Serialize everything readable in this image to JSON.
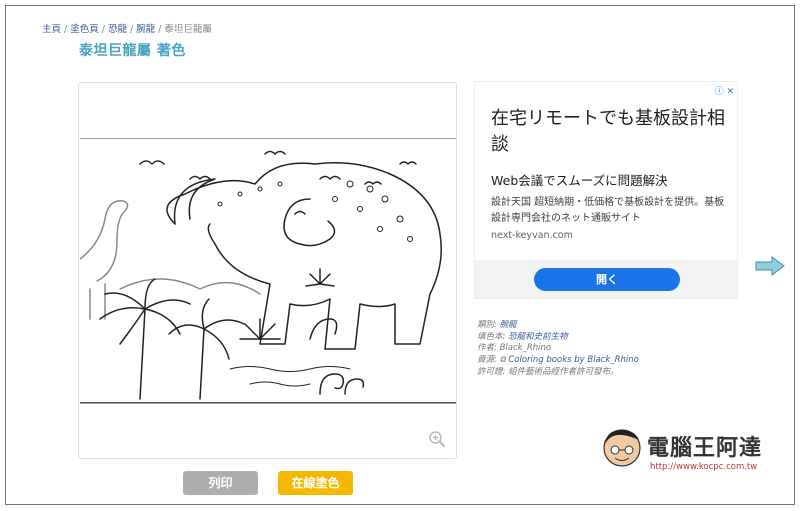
{
  "breadcrumb": {
    "items": [
      "主頁",
      "塗色頁",
      "恐龍",
      "腕龍"
    ],
    "current": "泰坦巨龍屬"
  },
  "page": {
    "title": "泰坦巨龍屬 著色"
  },
  "buttons": {
    "print": "列印",
    "online_color": "在線塗色"
  },
  "ad": {
    "headline": "在宅リモートでも基板設計相談",
    "subheadline": "Web会議でスムーズに問題解決",
    "body": "設計天国 超短納期・低価格で基板設計を提供。基板設計専門会社のネット通販サイト",
    "url": "next-keyvan.com",
    "cta": "開く"
  },
  "meta": {
    "category_label": "類別:",
    "category_value": "腕龍",
    "book_label": "填色本:",
    "book_value": "恐龍和史前生物",
    "author_label": "作者:",
    "author_value": "Black_Rhino",
    "source_label": "資源:",
    "source_value": "Coloring books by Black_Rhino",
    "license_label": "許可證:",
    "license_value": "組件藝術品經作者許可發布。"
  },
  "watermark": {
    "text": "電腦王阿達",
    "url": "http://www.kocpc.com.tw"
  },
  "colors": {
    "title": "#4aa3c2",
    "print_button": "#aeaeae",
    "color_button": "#f5b800",
    "ad_cta": "#1a73e8"
  }
}
